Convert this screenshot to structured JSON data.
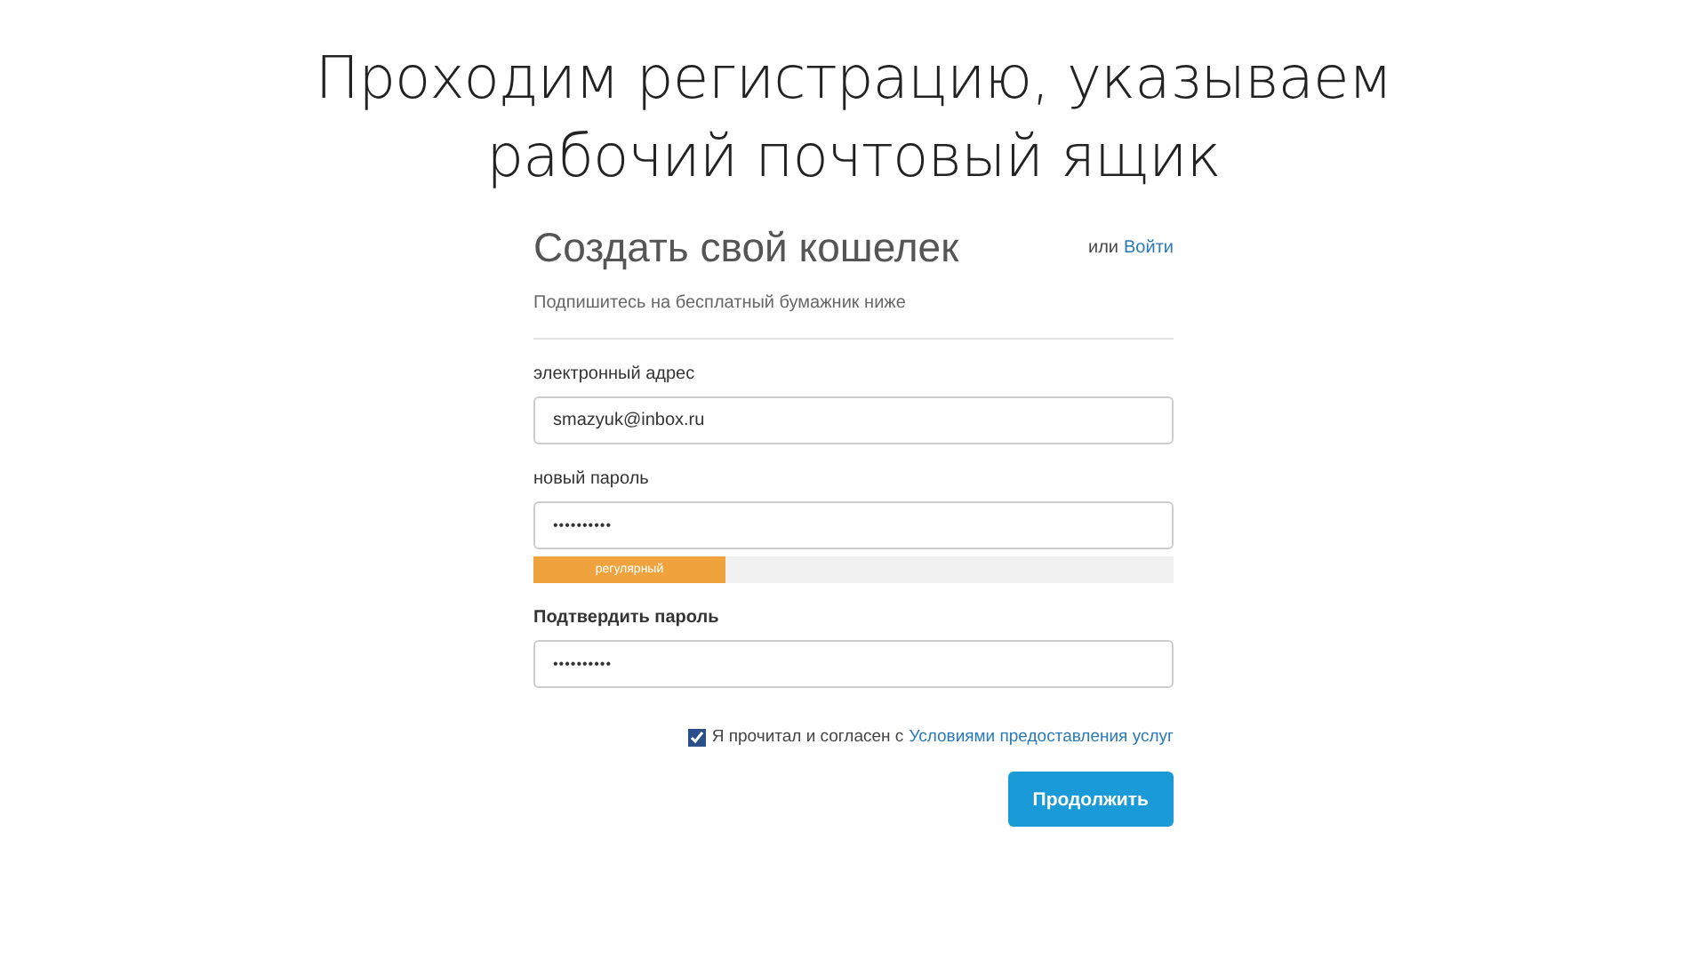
{
  "slide": {
    "title_lines": [
      "Проходим регистрацию, указываем",
      "рабочий почтовый ящик"
    ]
  },
  "form": {
    "title": "Создать свой кошелек",
    "alt_prefix": "или",
    "alt_link": "Войти",
    "subtitle": "Подпишитесь на бесплатный бумажник ниже",
    "fields": [
      {
        "label": "электронный адрес",
        "value": "smazyuk@inbox.ru",
        "kind": "text"
      },
      {
        "label": "новый пароль",
        "value": "••••••••••",
        "kind": "password",
        "strength": {
          "label": "регулярный",
          "level": 0.3
        }
      },
      {
        "label": "Подтвердить пароль",
        "value": "••••••••••",
        "kind": "password"
      }
    ],
    "agree": {
      "checked": true,
      "text": "Я прочитал и согласен с",
      "link": "Условиями предоставления услуг"
    },
    "submit": "Продолжить"
  }
}
